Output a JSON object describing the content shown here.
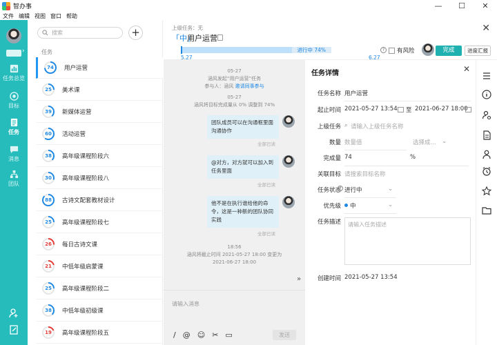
{
  "app": {
    "title": "智办事"
  },
  "window": {
    "minimize": "—",
    "maximize": "☐",
    "close": "✕"
  },
  "menu": [
    "文件",
    "编辑",
    "视图",
    "窗口",
    "帮助"
  ],
  "colors": {
    "teal": "#27bcbc",
    "blue": "#1e88e5",
    "red": "#e53935",
    "bubble": "#dff0f8"
  },
  "nav": {
    "items": [
      {
        "label": "任务总览",
        "icon": "chart-icon"
      },
      {
        "label": "目标",
        "icon": "target-icon"
      },
      {
        "label": "任务",
        "icon": "task-icon"
      },
      {
        "label": "消息",
        "icon": "message-icon"
      },
      {
        "label": "团队",
        "icon": "team-icon"
      }
    ],
    "bottom_icons": [
      "add-member-icon",
      "edit-note-icon"
    ]
  },
  "list": {
    "search_placeholder": "搜索",
    "add_label": "+",
    "header": "任务",
    "tasks": [
      {
        "name": "用户运营",
        "progress": 74,
        "color": "#1e88e5"
      },
      {
        "name": "美术课",
        "progress": 25,
        "color": "#1e88e5"
      },
      {
        "name": "新媒体运营",
        "progress": 39,
        "color": "#1e88e5"
      },
      {
        "name": "活动运营",
        "progress": 60,
        "color": "#1e88e5"
      },
      {
        "name": "高年级课程阶段六",
        "progress": 38,
        "color": "#1e88e5"
      },
      {
        "name": "高年级课程阶段八",
        "progress": 30,
        "color": "#1e88e5"
      },
      {
        "name": "古诗文配套教材设计",
        "progress": 88,
        "color": "#1e88e5"
      },
      {
        "name": "高年级课程阶段七",
        "progress": 25,
        "color": "#1e88e5"
      },
      {
        "name": "每日古诗文课",
        "progress": 26,
        "color": "#e53935"
      },
      {
        "name": "中低年级启蒙课",
        "progress": 21,
        "color": "#e53935"
      },
      {
        "name": "高年级课程阶段二",
        "progress": 25,
        "color": "#1e88e5"
      },
      {
        "name": "中低年级初级课",
        "progress": 38,
        "color": "#1e88e5"
      },
      {
        "name": "高年级课程阶段五",
        "progress": 19,
        "color": "#e53935"
      }
    ]
  },
  "header": {
    "parent_task": "上级任务：无",
    "priority_tag": "「中」",
    "title": "用户运营",
    "progress_label": "进行中 74%",
    "progress": 0.74,
    "start_date": "5.27",
    "end_date": "6.27",
    "risk_label": "有风险",
    "help": "?",
    "done_label": "完成",
    "report_label": "进度汇报",
    "close": "✕"
  },
  "chat": {
    "messages": [
      {
        "kind": "sys",
        "lines": [
          "05-27",
          "涵风发起“用户运营”任务",
          "参与人：涵风  邀请同事参与"
        ]
      },
      {
        "kind": "sys",
        "lines": [
          "05-27",
          "涵风将目标完成量从 0% 调整到 74%"
        ]
      },
      {
        "kind": "bubble",
        "text": "团队成员可以在沟通框里面沟通协作",
        "read": "全部已读"
      },
      {
        "kind": "bubble",
        "text": "@对方，对方就可以加入到任务里面",
        "read": "全部已读"
      },
      {
        "kind": "bubble",
        "text": "他不是在执行谁给他的命令，这是一种新的团队协同实践",
        "read": "全部已读"
      },
      {
        "kind": "sys",
        "lines": [
          "18:56",
          "涵风将截止时间 2021-05-27 18:00 变更为",
          "2021-06-27 18:00"
        ]
      }
    ],
    "invite_link": "邀请同事参与",
    "input_placeholder": "请输入消息",
    "send_label": "发送",
    "expand": "»",
    "tools": [
      "/",
      "@",
      "☺",
      "✂",
      "▭"
    ]
  },
  "details": {
    "title": "任务详情",
    "close": "✕",
    "name_label": "任务名称",
    "name_value": "用户运营",
    "time_label": "起止时间",
    "start": "2021-05-27 13:54",
    "to": "至",
    "end": "2021-06-27 18:00",
    "parent_label": "上级任务",
    "parent_placeholder": "请输入上级任务名称",
    "qty_label": "数量",
    "qty_placeholder": "数量值",
    "unit_placeholder": "选择成...",
    "done_label": "完成量",
    "done_value": "74",
    "done_unit": "%",
    "goal_label": "关联目标",
    "goal_placeholder": "请搜索目标名称",
    "status_label": "任务状态",
    "status_value": "进行中",
    "priority_label": "优先级",
    "priority_value": "中",
    "desc_label": "任务描述",
    "desc_placeholder": "请输入任务描述",
    "created_label": "创建时间",
    "created_value": "2021-05-27 13:54"
  },
  "rightbar_icons": [
    "list-icon",
    "info-icon",
    "person-gear-icon",
    "file-icon",
    "user-icon",
    "alarm-icon",
    "star-icon",
    "folder-icon"
  ]
}
